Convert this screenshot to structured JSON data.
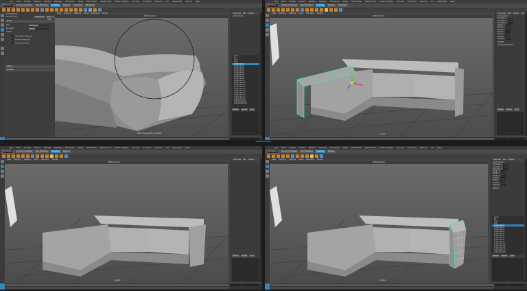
{
  "app": {
    "mode": "Modeling",
    "workspace": "Maya Classic"
  },
  "menus": [
    "File",
    "Edit",
    "Create",
    "Select",
    "Modify",
    "Display",
    "Windows",
    "Mesh",
    "Edit Mesh",
    "Mesh Tools",
    "Mesh Display",
    "Curves",
    "Surfaces",
    "Deform",
    "UV",
    "Generate",
    "Cache",
    "Arnold",
    "Help"
  ],
  "shelf_tabs": [
    "Curves / Surfaces",
    "Poly Modeling",
    "Sculpting",
    "Rigging",
    "Animation",
    "Rendering",
    "FX"
  ],
  "active_shelf": "Sculpting",
  "viewport_menu": [
    "View",
    "Shading",
    "Lighting",
    "Show",
    "Renderer",
    "Panels"
  ],
  "srgb": "sRGB gamma",
  "no_live": "No Live Surface",
  "channel_box": {
    "tabs": [
      "Channels",
      "Edit",
      "Object",
      "Show"
    ],
    "object": "polySurface1",
    "attributes": [
      "Translate X",
      "Translate Y",
      "Translate Z",
      "Rotate X",
      "Rotate Y",
      "Rotate Z",
      "Scale X",
      "Scale Y",
      "Scale Z",
      "Visibility"
    ],
    "shapes_label": "SHAPES",
    "shape_name": "polySurfaceShape1",
    "inputs_label": "INPUTS"
  },
  "layer_tabs": [
    "Display",
    "Render",
    "Anim"
  ],
  "layer_menu": [
    "Layers",
    "Options",
    "Help"
  ],
  "tool_settings": {
    "title": "Tool Settings",
    "tool": "Smooth Tool",
    "reset": "Reset Tool",
    "help": "Tool Help",
    "section": "Brush",
    "size_label": "Size",
    "strength_label": "Strength",
    "falloff_label": "Falloff",
    "size_value": 0.45,
    "strength_value": 0.3,
    "checks": [
      "Use Stylus Pressure",
      "Screen Projection",
      "Lock Brush Size"
    ],
    "sections": [
      "Stroke",
      "Display"
    ]
  },
  "outliner": {
    "items": [
      "persp",
      "top",
      "front",
      "side",
      "polySurface1",
      "polySurface2",
      "polySurface3",
      "polySurface4",
      "polySurface5",
      "polySurface6",
      "polySurface7",
      "polySurface8",
      "polySurface9",
      "polySurface10",
      "polySurface11",
      "polySurface12",
      "polySurface13",
      "polySurface14",
      "polySurface15",
      "polySurface16",
      "polySurface17",
      "polySurface18",
      "defaultLightSet",
      "defaultObjectSet"
    ],
    "selected": "polySurface1"
  },
  "camera": "persp",
  "tooltip": "Hold to smooth surface",
  "timeline": {
    "start": "1",
    "end": "120",
    "frame": "1",
    "fps": "24 fps",
    "character": "No Character Set",
    "anim_layer": "No Anim Layer"
  },
  "command": "MEL",
  "center_caption": "Adobe Illustrator",
  "colors": {
    "accent": "#2e87c5",
    "selection": "#3df5a5"
  }
}
